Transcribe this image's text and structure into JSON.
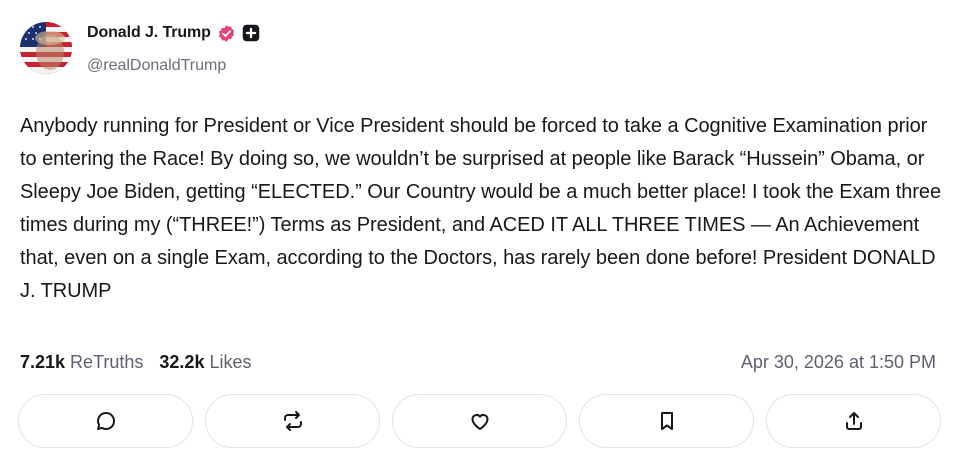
{
  "author": {
    "display_name": "Donald J. Trump",
    "handle": "@realDonaldTrump",
    "avatar": "avatar-flag-portrait",
    "verified_icon": "verified-badge-icon",
    "plus_icon": "plus-badge-icon"
  },
  "post": {
    "text": "Anybody running for President or Vice President should be forced to take a Cognitive Examination prior to entering the Race! By doing so, we wouldn’t be surprised at people like Barack “Hussein” Obama, or Sleepy Joe Biden, getting “ELECTED.” Our Country would be a much better place! I took the Exam three times during my (“THREE!”) Terms as President, and ACED IT ALL THREE TIMES — An Achievement that, even on a single Exam, according to the Doctors, has rarely been done before! President DONALD J. TRUMP"
  },
  "stats": {
    "retruths_count": "7.21k",
    "retruths_label": "ReTruths",
    "likes_count": "32.2k",
    "likes_label": "Likes",
    "timestamp": "Apr 30, 2026 at 1:50 PM"
  },
  "actions": [
    {
      "name": "reply",
      "icon": "comment-icon"
    },
    {
      "name": "retruth",
      "icon": "repost-icon"
    },
    {
      "name": "like",
      "icon": "heart-icon"
    },
    {
      "name": "bookmark",
      "icon": "bookmark-icon"
    },
    {
      "name": "share",
      "icon": "share-icon"
    }
  ],
  "colors": {
    "accent": "#e0457b",
    "text": "#17181c",
    "muted": "#5d6070",
    "border": "#e3e4e8"
  }
}
